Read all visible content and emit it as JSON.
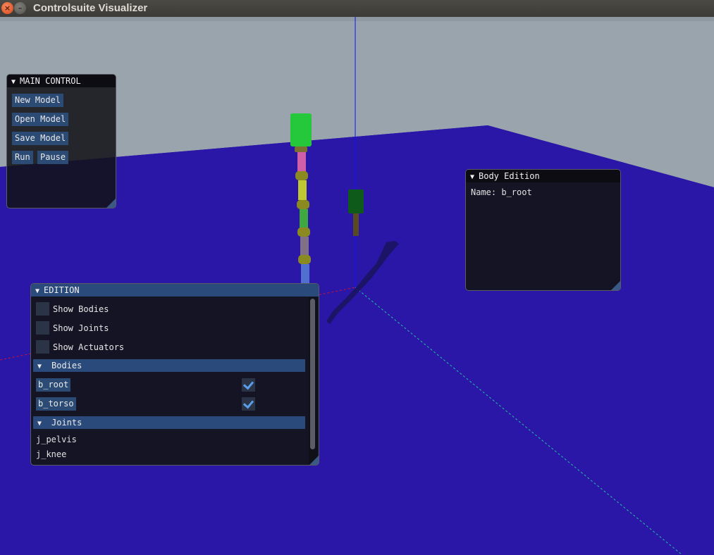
{
  "window": {
    "title": "Controlsuite Visualizer"
  },
  "main_control": {
    "title": "MAIN CONTROL",
    "new_model": "New Model",
    "open_model": "Open Model",
    "save_model": "Save Model",
    "run": "Run",
    "pause": "Pause"
  },
  "body_edition": {
    "title": "Body Edition",
    "name_line": "Name: b_root"
  },
  "edition": {
    "title": "EDITION",
    "show_bodies": {
      "label": "Show Bodies",
      "checked": false
    },
    "show_joints": {
      "label": "Show Joints",
      "checked": false
    },
    "show_actuators": {
      "label": "Show Actuators",
      "checked": false
    },
    "bodies_header": "Bodies",
    "bodies": [
      {
        "name": "b_root",
        "checked": true
      },
      {
        "name": "b_torso",
        "checked": true
      }
    ],
    "joints_header": "Joints",
    "joints": [
      "j_pelvis",
      "j_knee"
    ]
  },
  "colors": {
    "sky": "#9aa4ac",
    "floor": "#2a17a8",
    "panel_accent": "#294a7a"
  }
}
